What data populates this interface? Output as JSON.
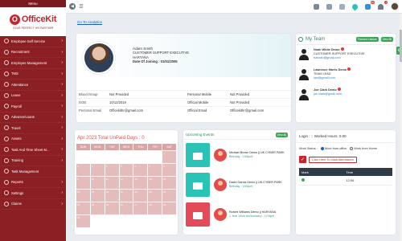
{
  "sidebar": {
    "header": "Menu",
    "logo_letter": "O",
    "logo_text": "OfficeKit",
    "logo_tag": "YOUR PERFECT HR PARTNER",
    "items": [
      {
        "label": "Employee Self Service"
      },
      {
        "label": "Recruitment"
      },
      {
        "label": "Employee Management"
      },
      {
        "label": "TMS"
      },
      {
        "label": "Attendance"
      },
      {
        "label": "Leave"
      },
      {
        "label": "Payroll"
      },
      {
        "label": "Advance/Loans"
      },
      {
        "label": "Travel"
      },
      {
        "label": "Assets"
      },
      {
        "label": "Task And Time Sheet M..."
      },
      {
        "label": "Training"
      },
      {
        "label": "Task Management"
      },
      {
        "label": "Reports"
      },
      {
        "label": "Settings"
      },
      {
        "label": "Claims"
      }
    ]
  },
  "topbar": {
    "menu_icon": "☰",
    "back_icon": "◀",
    "notif_count_1": "36",
    "notif_count_2": "1"
  },
  "breadcrumb": "Go To Analytics",
  "profile": {
    "name": "Adam Smith",
    "designation": "CUSTOMER SUPPORT EXECUTIVE",
    "location": "HARYANA",
    "doj_label": "Date Of Joining : ",
    "doj_value": "01/01/2005",
    "rows": [
      {
        "k1": "Blood Group",
        "v1": "Not Provided",
        "k2": "Personal Mobile",
        "v2": "Not Provided"
      },
      {
        "k1": "DOB",
        "v1": "10/12/2019",
        "k2": "Official Mobile",
        "v2": "Not Provided"
      },
      {
        "k1": "Personal Email",
        "v1": "Officekithr@gmail.com",
        "k2": "Official Email",
        "v2": "Officekithr@gmail.com"
      }
    ]
  },
  "team": {
    "title": "My Team",
    "pill1": "Planned Leaves",
    "pill2": "View All",
    "members": [
      {
        "name": "Noah White Demo",
        "role": "CUSTOMER SUPPORT EXECUTIVE",
        "email": "tstnoah@gmail.com"
      },
      {
        "name": "Lawrence Harris Demo",
        "role": "TEAM LEAD",
        "email": "law@gmail.com"
      },
      {
        "name": "Joe Clark Demo",
        "role": "",
        "email": "joe.clark@gmail.com"
      }
    ]
  },
  "calendar": {
    "title": "Apr 2023 Total UnPaid Days : 0",
    "days": [
      "SUN",
      "MON",
      "TUE",
      "WED",
      "THU",
      "FRI",
      "SAT"
    ],
    "cells": [
      "",
      "",
      "",
      "",
      "",
      "",
      "1",
      "2",
      "3",
      "4",
      "5",
      "6",
      "7",
      "8",
      "9",
      "10",
      "11",
      "12",
      "13",
      "14",
      "15",
      "16",
      "17",
      "18",
      "19",
      "20",
      "21",
      "22",
      "23",
      "24",
      "25",
      "26",
      "27",
      "28",
      "29",
      "30"
    ]
  },
  "events": {
    "title": "Upcoming Events",
    "view_all": "View All",
    "items": [
      {
        "name": "Michael Brown Demo || UK CYBER PARK",
        "sub": "Birthday - 15/April",
        "type": "birthday"
      },
      {
        "name": "David Garcia Demo || UK CYBER PARK",
        "sub": "Birthday - 15/April",
        "type": "birthday"
      },
      {
        "name": "Robert Williams Demo || HARYANA",
        "sub": "1 Year Work Anniversary - 17/April",
        "type": "anniversary"
      }
    ]
  },
  "login": {
    "login_label": "Login :",
    "worked_label": "Worked Hours: 0.00",
    "work_status_label": "Work Status :",
    "opt1": "Work from office",
    "opt2": "Work from Home",
    "mark_btn": "Click Here To Mark Attendance",
    "col_mark": "Mark",
    "col_time": "Time",
    "row_time": "12:06"
  }
}
